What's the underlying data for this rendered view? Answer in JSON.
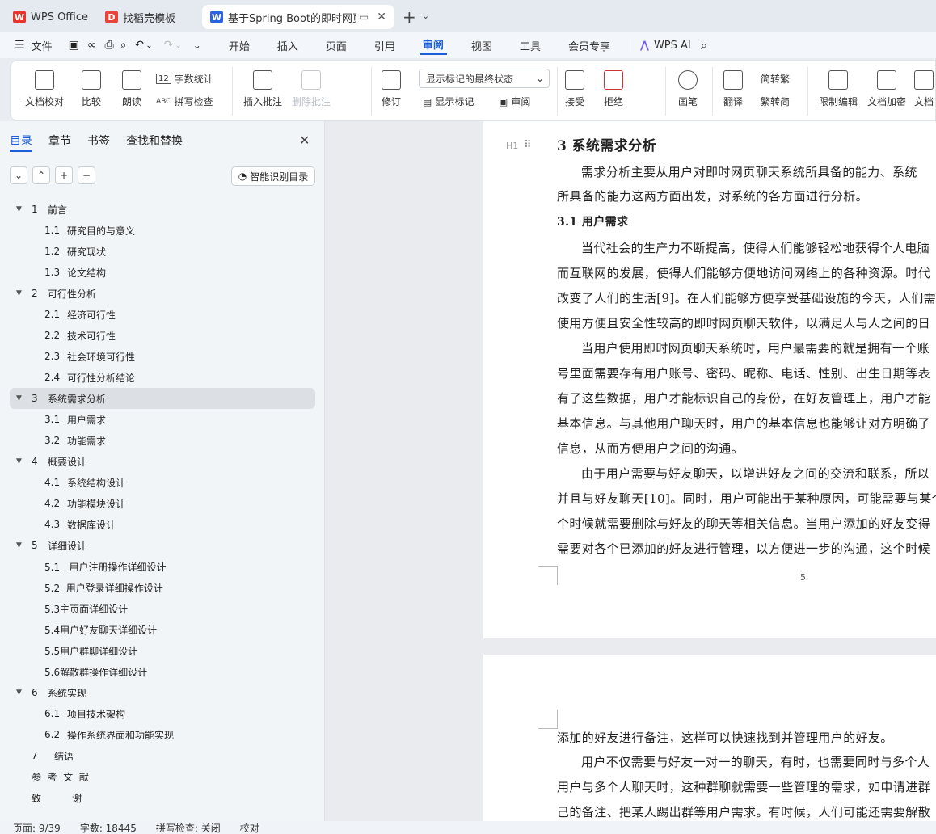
{
  "tabs": [
    {
      "label": "WPS Office",
      "icon": "wps-logo-icon"
    },
    {
      "label": "找稻壳模板",
      "icon": "docer-icon"
    },
    {
      "label": "基于Spring Boot的即时网页聊",
      "icon": "word-doc-icon"
    }
  ],
  "menu": {
    "file": "文件",
    "items": [
      "开始",
      "插入",
      "页面",
      "引用",
      "审阅",
      "视图",
      "工具",
      "会员专享"
    ],
    "active": "审阅",
    "ai": "WPS AI"
  },
  "ribbon": {
    "doc_check": "文档校对",
    "compare": "比较",
    "read_aloud": "朗读",
    "word_count": "字数统计",
    "spell_check": "拼写检查",
    "insert_comment": "插入批注",
    "delete_comment": "删除批注",
    "revise": "修订",
    "markup_select": "显示标记的最终状态",
    "show_markup": "显示标记",
    "review": "审阅",
    "accept": "接受",
    "reject": "拒绝",
    "pen": "画笔",
    "translate": "翻译",
    "to_traditional": "简转繁",
    "to_simplified": "繁转简",
    "restrict_edit": "限制编辑",
    "doc_encrypt": "文档加密",
    "doc_more": "文档"
  },
  "sidebar": {
    "tabs": [
      "目录",
      "章节",
      "书签",
      "查找和替换"
    ],
    "smart_toc": "智能识别目录",
    "toc": [
      {
        "num": "1",
        "title": "前言",
        "level": 1
      },
      {
        "num": "1.1",
        "title": "研究目的与意义",
        "level": 2
      },
      {
        "num": "1.2",
        "title": "研究现状",
        "level": 2
      },
      {
        "num": "1.3",
        "title": "论文结构",
        "level": 2
      },
      {
        "num": "2",
        "title": "可行性分析",
        "level": 1
      },
      {
        "num": "2.1",
        "title": "经济可行性",
        "level": 2
      },
      {
        "num": "2.2",
        "title": "技术可行性",
        "level": 2
      },
      {
        "num": "2.3",
        "title": "社会环境可行性",
        "level": 2
      },
      {
        "num": "2.4",
        "title": "可行性分析结论",
        "level": 2
      },
      {
        "num": "3",
        "title": "系统需求分析",
        "level": 1,
        "selected": true
      },
      {
        "num": "3.1",
        "title": "用户需求",
        "level": 2
      },
      {
        "num": "3.2",
        "title": "功能需求",
        "level": 2
      },
      {
        "num": "4",
        "title": "概要设计",
        "level": 1
      },
      {
        "num": "4.1",
        "title": "系统结构设计",
        "level": 2
      },
      {
        "num": "4.2",
        "title": "功能模块设计",
        "level": 2
      },
      {
        "num": "4.3",
        "title": "数据库设计",
        "level": 2
      },
      {
        "num": "5",
        "title": "详细设计",
        "level": 1
      },
      {
        "num": "",
        "title": "5.1   用户注册操作详细设计",
        "level": 2
      },
      {
        "num": "",
        "title": "5.2  用户登录详细操作设计",
        "level": 2
      },
      {
        "num": "",
        "title": "5.3主页面详细设计",
        "level": 2
      },
      {
        "num": "",
        "title": "5.4用户好友聊天详细设计",
        "level": 2
      },
      {
        "num": "",
        "title": "5.5用户群聊详细设计",
        "level": 2
      },
      {
        "num": "",
        "title": "5.6解散群操作详细设计",
        "level": 2
      },
      {
        "num": "6",
        "title": "系统实现",
        "level": 1
      },
      {
        "num": "6.1",
        "title": "项目技术架构",
        "level": 2
      },
      {
        "num": "6.2",
        "title": "操作系统界面和功能实现",
        "level": 2
      },
      {
        "num": "7",
        "title": "结语",
        "level": "1x"
      },
      {
        "num": "",
        "title": "参  考  文  献",
        "level": "1x"
      },
      {
        "num": "",
        "title": "致          谢",
        "level": "1x"
      }
    ]
  },
  "doc": {
    "heading": "3     系统需求分析",
    "heading_marker": "H1",
    "p1": "需求分析主要从用户对即时网页聊天系统所具备的能力、系统",
    "p1b": "所具备的能力这两方面出发，对系统的各方面进行分析。",
    "h31": "3.1     用户需求",
    "p2": [
      "当代社会的生产力不断提高，使得人们能够轻松地获得个人电脑",
      "而互联网的发展，使得人们能够方便地访问网络上的各种资源。时代",
      "改变了人们的生活[9]。在人们能够方便享受基础设施的今天，人们需",
      "使用方便且安全性较高的即时网页聊天软件，以满足人与人之间的日"
    ],
    "p3": [
      "当用户使用即时网页聊天系统时，用户最需要的就是拥有一个账",
      "号里面需要存有用户账号、密码、昵称、电话、性别、出生日期等表",
      "有了这些数据，用户才能标识自己的身份，在好友管理上，用户才能",
      "基本信息。与其他用户聊天时，用户的基本信息也能够让对方明确了",
      "信息，从而方便用户之间的沟通。"
    ],
    "p4": [
      "由于用户需要与好友聊天，以增进好友之间的交流和联系，所以",
      "并且与好友聊天[10]。同时，用户可能出于某种原因，可能需要与某个",
      "个时候就需要删除与好友的聊天等相关信息。当用户添加的好友变得",
      "需要对各个已添加的好友进行管理，以方便进一步的沟通，这个时候"
    ],
    "page_num": "5",
    "p5": "添加的好友进行备注，这样可以快速找到并管理用户的好友。",
    "p6": [
      "用户不仅需要与好友一对一的聊天，有时，也需要同时与多个人",
      "用户与多个人聊天时，这种群聊就需要一些管理的需求，如申请进群",
      "己的备注、把某人踢出群等用户需求。有时候，人们可能还需要解散"
    ]
  },
  "status": {
    "page": "页面: 9/39",
    "words": "字数: 18445",
    "spell": "拼写检查: 关闭",
    "proof": "校对"
  }
}
